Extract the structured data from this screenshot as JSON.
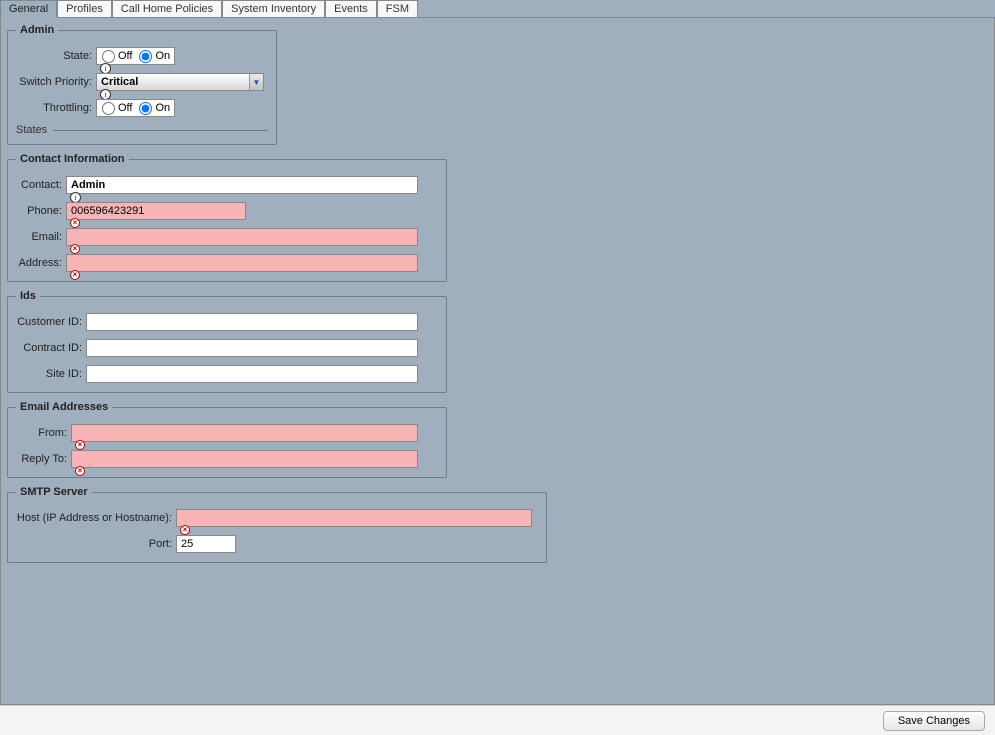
{
  "tabs": {
    "t0": "General",
    "t1": "Profiles",
    "t2": "Call Home Policies",
    "t3": "System Inventory",
    "t4": "Events",
    "t5": "FSM"
  },
  "admin": {
    "legend": "Admin",
    "state_label": "State:",
    "off": "Off",
    "on": "On",
    "state_value": "On",
    "switch_priority_label": "Switch Priority:",
    "switch_priority_value": "Critical",
    "throttling_label": "Throttling:",
    "throttling_value": "On",
    "states_label": "States"
  },
  "contact": {
    "legend": "Contact Information",
    "contact_label": "Contact:",
    "contact_value": "Admin",
    "phone_label": "Phone:",
    "phone_value": "006596423291",
    "email_label": "Email:",
    "email_value": "",
    "address_label": "Address:",
    "address_value": ""
  },
  "ids": {
    "legend": "Ids",
    "customer_label": "Customer ID:",
    "customer_value": "",
    "contract_label": "Contract ID:",
    "contract_value": "",
    "site_label": "Site ID:",
    "site_value": ""
  },
  "emails": {
    "legend": "Email Addresses",
    "from_label": "From:",
    "from_value": "",
    "reply_label": "Reply To:",
    "reply_value": ""
  },
  "smtp": {
    "legend": "SMTP Server",
    "host_label": "Host (IP Address or Hostname):",
    "host_value": "",
    "port_label": "Port:",
    "port_value": "25"
  },
  "footer": {
    "save": "Save Changes"
  }
}
